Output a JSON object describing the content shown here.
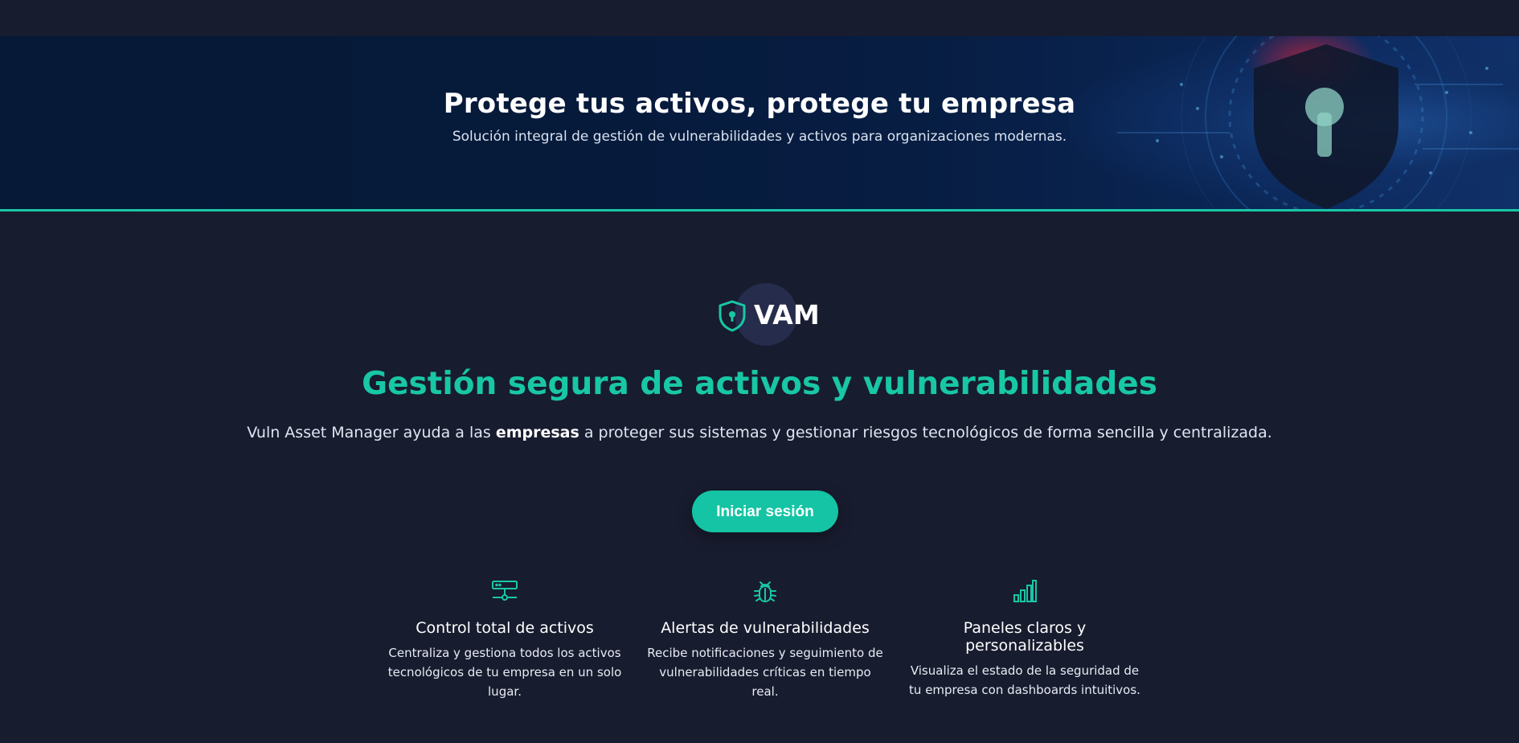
{
  "hero": {
    "title": "Protege tus activos, protege tu empresa",
    "subtitle": "Solución integral de gestión de vulnerabilidades y activos para organizaciones modernas."
  },
  "brand": {
    "logo_icon": "shield-keyhole-icon",
    "name": "VAM"
  },
  "main": {
    "title": "Gestión segura de activos y vulnerabilidades",
    "description_before": "Vuln Asset Manager ayuda a las ",
    "description_bold": "empresas",
    "description_after": " a proteger sus sistemas y gestionar riesgos tecnológicos de forma sencilla y centralizada.",
    "login_label": "Iniciar sesión"
  },
  "features": [
    {
      "icon": "server-network-icon",
      "title": "Control total de activos",
      "text": "Centraliza y gestiona todos los activos tecnológicos de tu empresa en un solo lugar."
    },
    {
      "icon": "bug-icon",
      "title": "Alertas de vulnerabilidades",
      "text": "Recibe notificaciones y seguimiento de vulnerabilidades críticas en tiempo real."
    },
    {
      "icon": "bar-chart-icon",
      "title": "Paneles claros y personalizables",
      "text": "Visualiza el estado de la seguridad de tu empresa con dashboards intuitivos."
    }
  ],
  "colors": {
    "background": "#181c2f",
    "accent": "#18c7a5",
    "hero_bg": "#061936"
  }
}
